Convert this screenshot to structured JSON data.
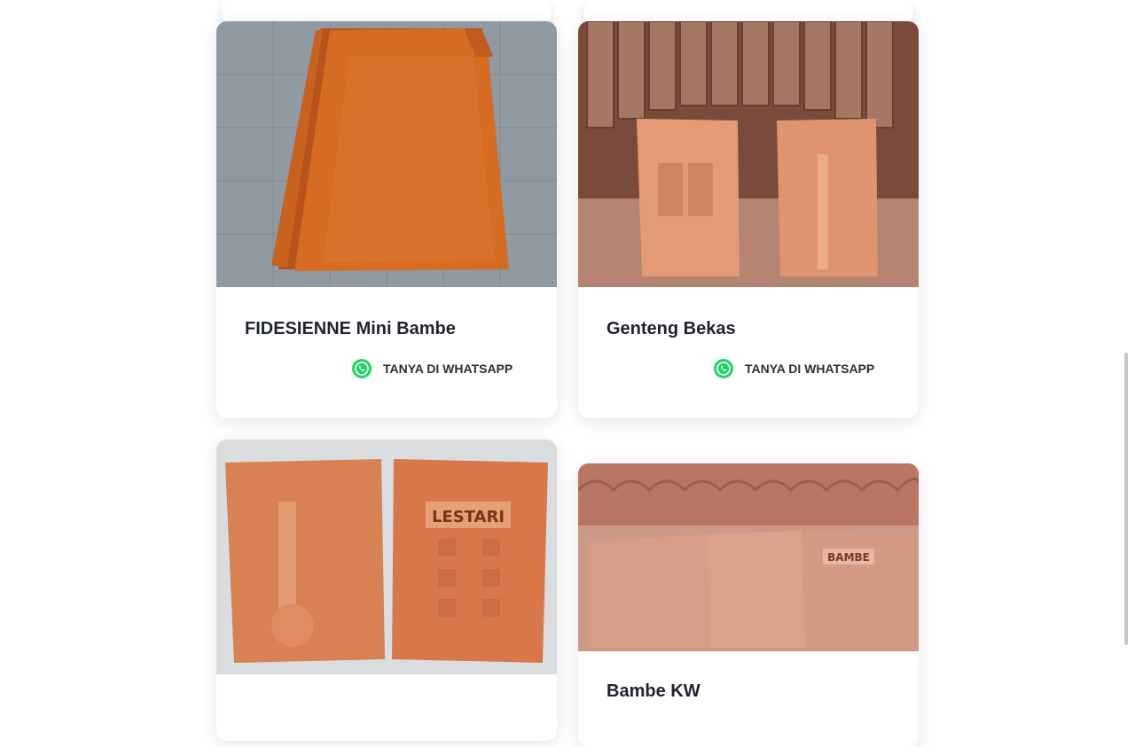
{
  "cards": [
    {
      "title": "FIDESIENNE Mini Bambe",
      "cta": "TANYA DI WHATSAPP",
      "image": "orange clay roof tile"
    },
    {
      "title": "Genteng Bekas",
      "cta": "TANYA DI WHATSAPP",
      "image": "used clay roof tiles"
    },
    {
      "title": "",
      "cta": "",
      "image": "clay tiles with LESTARI stamp",
      "stamp": "LESTARI"
    },
    {
      "title": "Bambe KW",
      "cta": "",
      "image": "stack of clay tiles with BAMBE stamp",
      "stamp": "BAMBE"
    }
  ],
  "colors": {
    "whatsapp": "#25D366",
    "title": "#1f2330",
    "tile": "#d46a2a",
    "tile_dark": "#b4531d"
  },
  "icons": {
    "cta_icon": "whatsapp-icon"
  }
}
